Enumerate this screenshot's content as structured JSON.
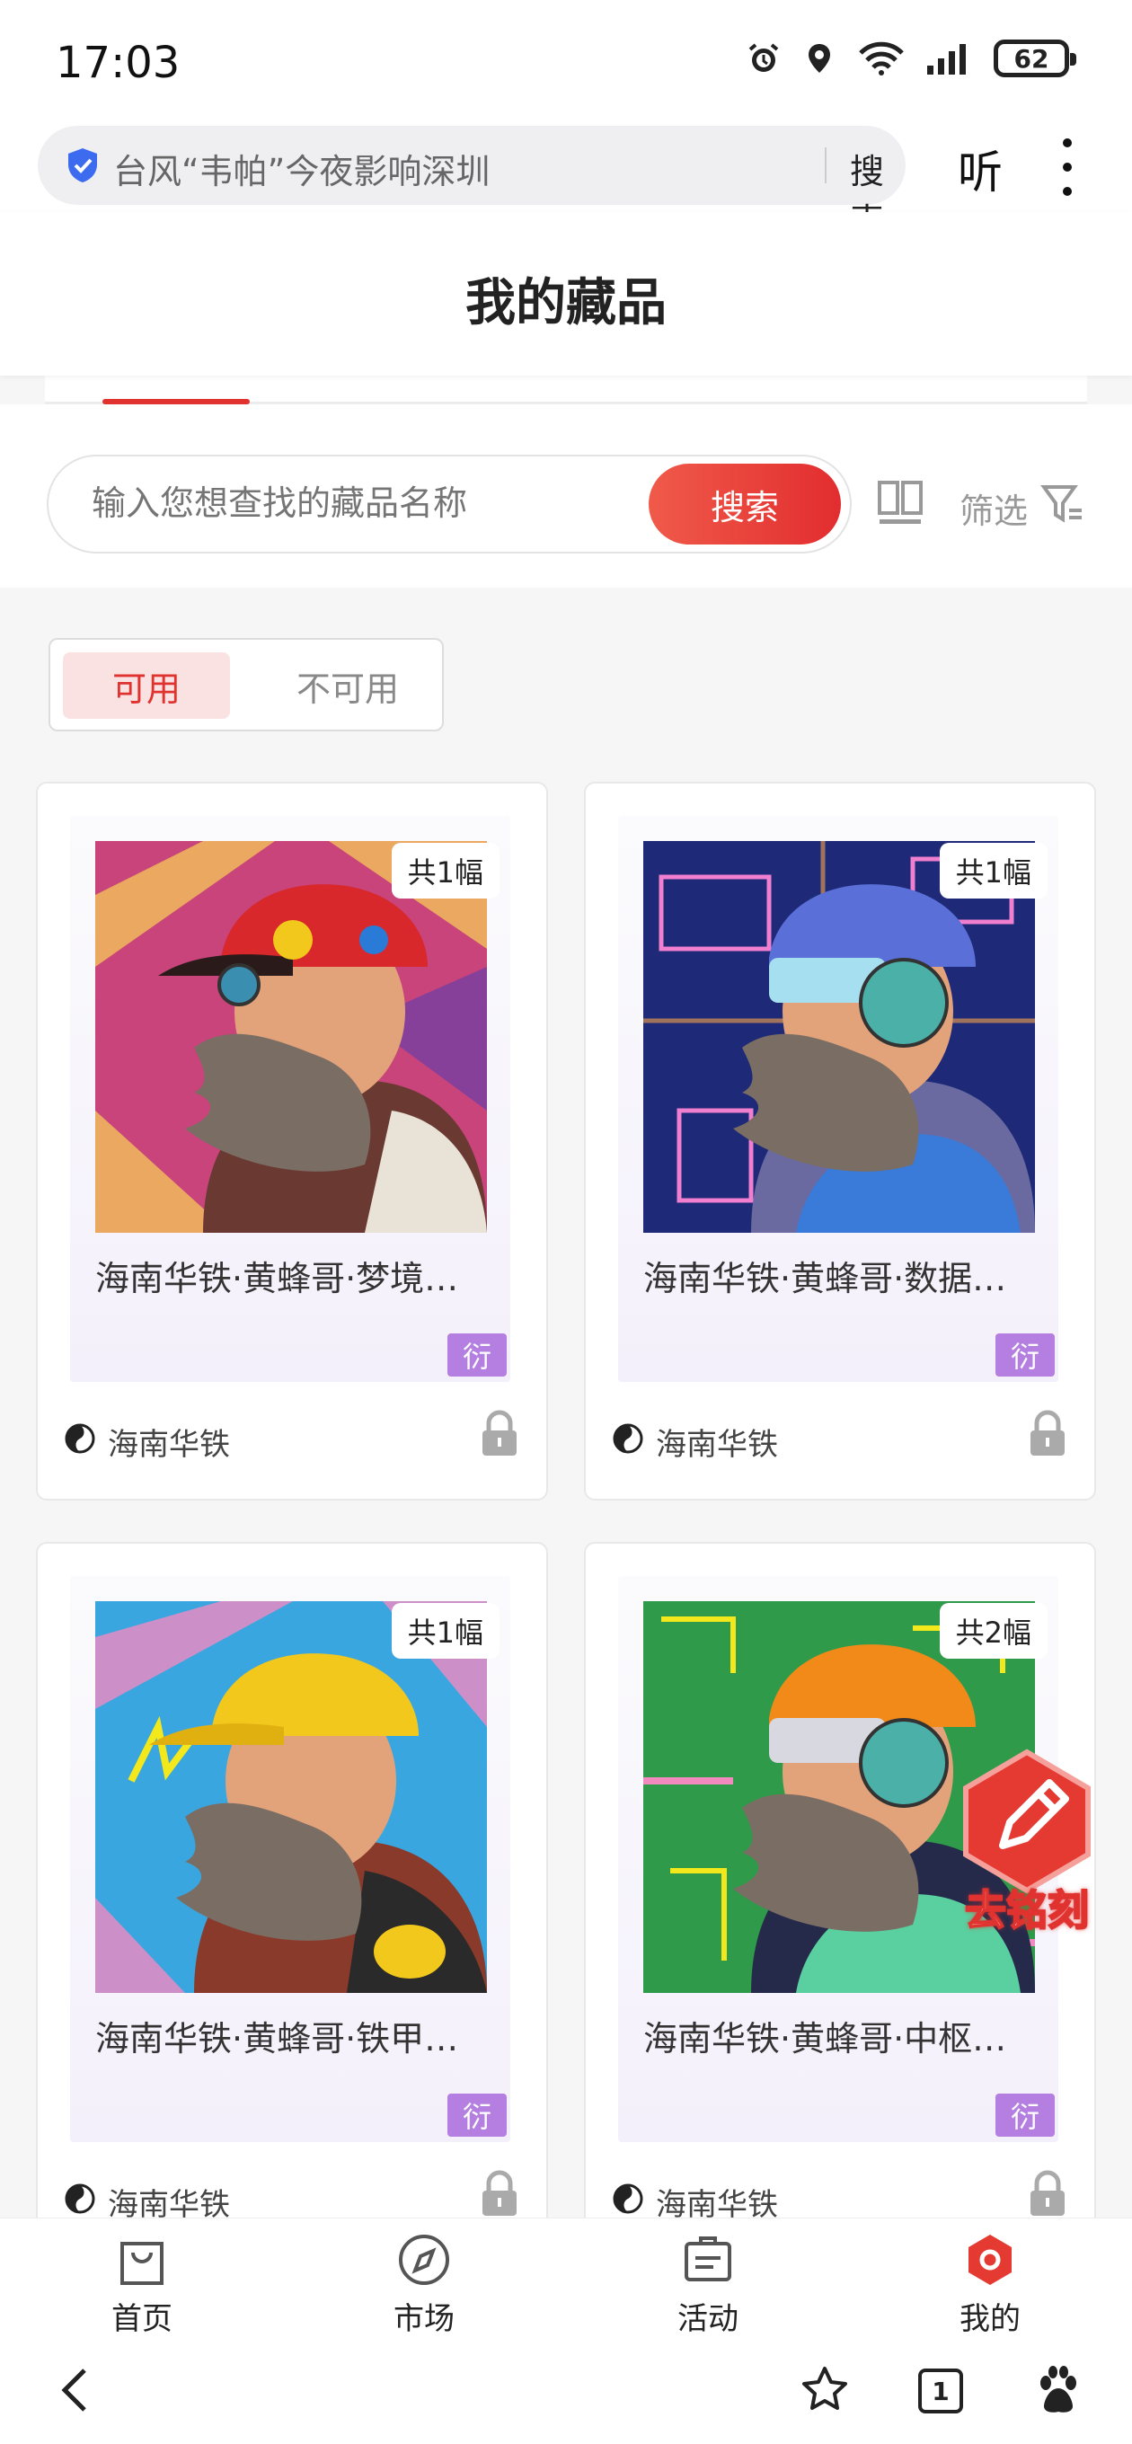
{
  "status_bar": {
    "time": "17:03",
    "battery": "62"
  },
  "browser": {
    "url_text": "台风“韦帕”今夜影响深圳",
    "search_label": "搜索",
    "listen_label": "听"
  },
  "header": {
    "title": "我的藏品"
  },
  "search": {
    "placeholder": "输入您想查找的藏品名称",
    "button_label": "搜索",
    "filter_label": "筛选"
  },
  "toggle": {
    "available": "可用",
    "unavailable": "不可用"
  },
  "cards": [
    {
      "name": "海南华铁·黄蜂哥·梦境…",
      "count": "共1幅",
      "tag": "衍",
      "issuer": "海南华铁",
      "bg": "#d04a8a",
      "helmet": "#d8282c"
    },
    {
      "name": "海南华铁·黄蜂哥·数据…",
      "count": "共1幅",
      "tag": "衍",
      "issuer": "海南华铁",
      "bg": "#1e2a78",
      "helmet": "#5b6fd8"
    },
    {
      "name": "海南华铁·黄蜂哥·铁甲…",
      "count": "共1幅",
      "tag": "衍",
      "issuer": "海南华铁",
      "bg": "#3aa6e0",
      "helmet": "#f2c81c"
    },
    {
      "name": "海南华铁·黄蜂哥·中枢…",
      "count": "共2幅",
      "tag": "衍",
      "issuer": "海南华铁",
      "bg": "#2f9a4a",
      "helmet": "#f28a1a"
    }
  ],
  "engrave": {
    "label": "去铭刻"
  },
  "bottom_nav": [
    {
      "label": "首页",
      "icon": "bag-icon"
    },
    {
      "label": "市场",
      "icon": "compass-icon"
    },
    {
      "label": "活动",
      "icon": "clipboard-icon"
    },
    {
      "label": "我的",
      "icon": "profile-icon"
    }
  ],
  "system_nav": {
    "tab_count": "1"
  },
  "colors": {
    "accent": "#e0322f",
    "tag": "#b47fe0"
  }
}
